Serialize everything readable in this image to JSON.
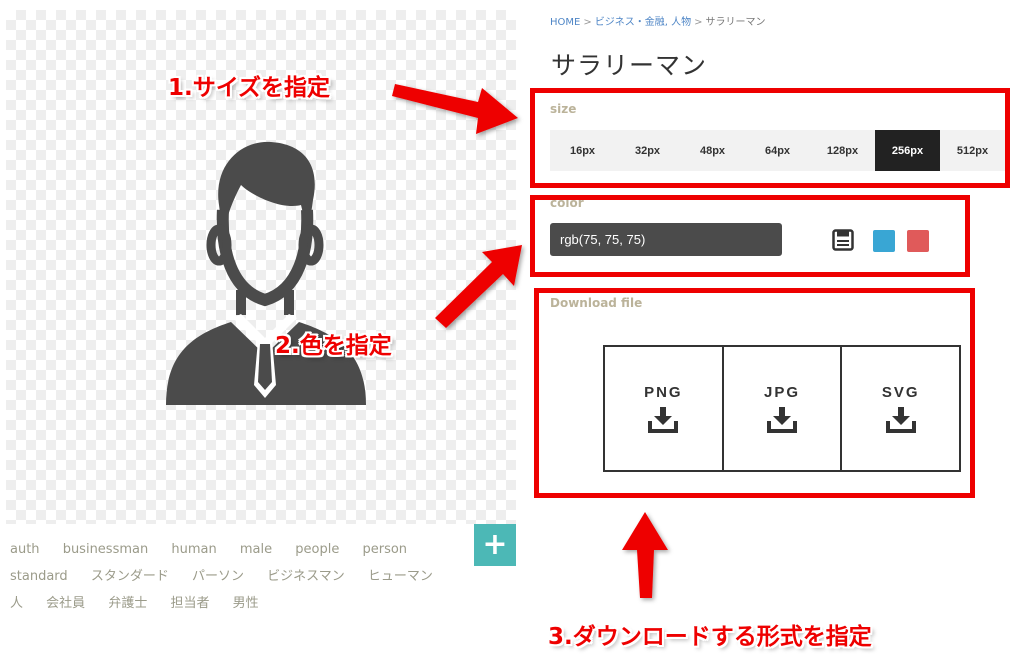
{
  "breadcrumb": {
    "home": "HOME",
    "category": "ビジネス・金融, 人物",
    "current": "サラリーマン",
    "separator": ">"
  },
  "page_title": "サラリーマン",
  "icon_color": "#4b4b4b",
  "size": {
    "label": "size",
    "options": [
      "16px",
      "32px",
      "48px",
      "64px",
      "128px",
      "256px",
      "512px"
    ],
    "selected": "256px"
  },
  "color": {
    "label": "color",
    "value": "rgb(75, 75, 75)",
    "swatches": [
      "#39a6d4",
      "#e05a5a"
    ]
  },
  "download": {
    "label": "Download file",
    "formats": [
      "PNG",
      "JPG",
      "SVG"
    ]
  },
  "tags": [
    "auth",
    "businessman",
    "human",
    "male",
    "people",
    "person",
    "standard",
    "スタンダード",
    "パーソン",
    "ビジネスマン",
    "ヒューマン",
    "人",
    "会社員",
    "弁護士",
    "担当者",
    "男性"
  ],
  "add_button": "+",
  "annotations": {
    "step1": "1.サイズを指定",
    "step2": "2.色を指定",
    "step3": "3.ダウンロードする形式を指定",
    "color": "#ee0000"
  }
}
